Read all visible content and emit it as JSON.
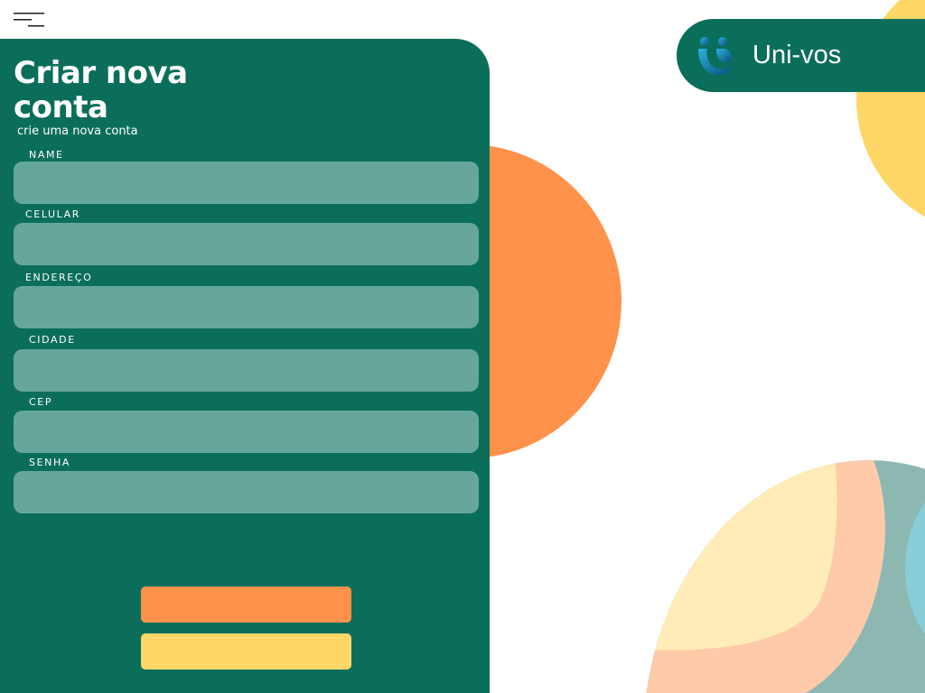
{
  "app": {
    "brand_name": "Uni-vos"
  },
  "form": {
    "title": "Criar nova conta",
    "subtitle": "crie uma nova conta",
    "fields": [
      {
        "label": "NAME",
        "value": "",
        "placeholder": ""
      },
      {
        "label": "CELULAR",
        "value": "",
        "placeholder": ""
      },
      {
        "label": "ENDEREÇO",
        "value": "",
        "placeholder": ""
      },
      {
        "label": "CIDADE",
        "value": "",
        "placeholder": ""
      },
      {
        "label": "CEP",
        "value": "",
        "placeholder": ""
      },
      {
        "label": "SENHA",
        "value": "",
        "placeholder": ""
      }
    ],
    "primary_button_label": "",
    "secondary_button_label": ""
  },
  "icons": {
    "menu": "menu-icon",
    "logo": "people-logo-icon"
  },
  "colors": {
    "primary_green": "#0b6e5a",
    "input_fill": "#67a79b",
    "accent_orange": "#ff924b",
    "accent_yellow": "#ffd766",
    "text_white": "#ffffff"
  }
}
